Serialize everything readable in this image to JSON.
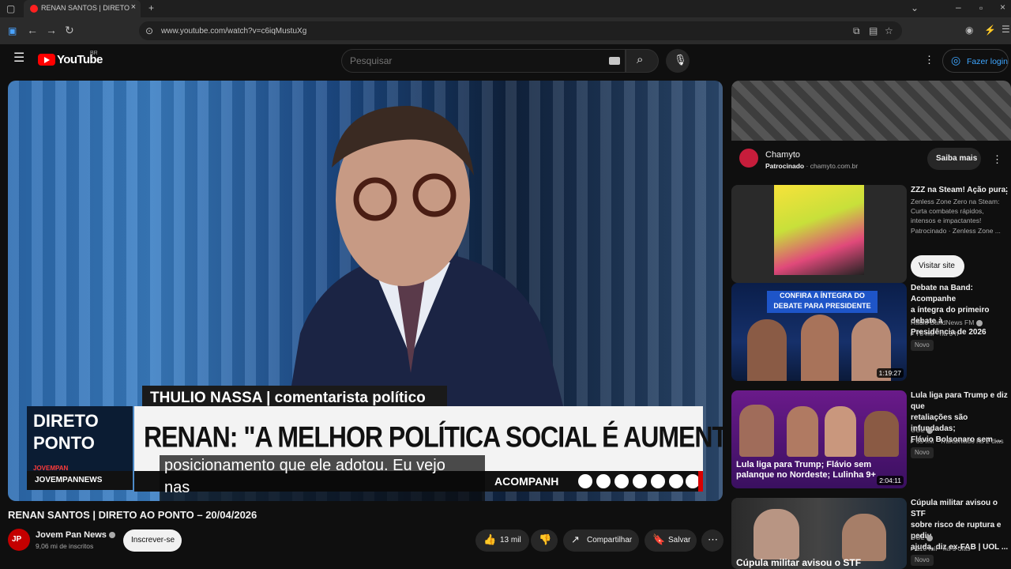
{
  "browser": {
    "tab_title": "RENAN SANTOS | DIRETO AO P",
    "url": "www.youtube.com/watch?v=c6iqMustuXg"
  },
  "header": {
    "logo_text": "YouTube",
    "country_code": "BR",
    "search_placeholder": "Pesquisar",
    "login_label": "Fazer login"
  },
  "video": {
    "lower_third_name": "THULIO NASSA | comentarista político",
    "headline": "RENAN: \"A MELHOR POLÍTICA SOCIAL É AUMENTAR A RENDA\"",
    "brand_line1": "DIRETO",
    "brand_line2": "PONTO",
    "brand_sub": "JOVEMPAN",
    "network": "JOVEMPANNEWS",
    "ticker": "ACOMPANH",
    "caption_line1": "posicionamento que ele adotou. Eu vejo",
    "caption_line2": "nas"
  },
  "info": {
    "title": "RENAN SANTOS | DIRETO AO PONTO – 20/04/2026",
    "channel": "Jovem Pan News",
    "subscribers": "9,06 mi de inscritos",
    "subscribe_label": "Inscrever-se",
    "likes": "13 mil",
    "share_label": "Compartilhar",
    "save_label": "Salvar",
    "avatar_text": "JP"
  },
  "sidebar": {
    "ad": {
      "name": "Chamyto",
      "sponsored": "Patrocinado",
      "domain": "chamyto.com.br",
      "cta": "Saiba mais"
    },
    "promo": {
      "title": "ZZZ na Steam! Ação pura.",
      "desc1": "Zenless Zone Zero na Steam:",
      "desc2": "Curta combates rápidos,",
      "desc3": "intensos e impactantes!",
      "sponsor": "Patrocinado · Zenless Zone ...",
      "cta": "Visitar site"
    },
    "items": [
      {
        "title_l1": "Debate na Band: Acompanhe",
        "title_l2": "a íntegra do primeiro debate à",
        "title_l3": "Presidência de 2026",
        "channel": "Rádio BandNews FM",
        "meta": "78 mil · há 9 h",
        "badge": "Novo",
        "duration": "1:19:27",
        "thumb_text": "CONFIRA A ÍNTEGRA DO DEBATE PARA PRESIDENTE"
      },
      {
        "title_l1": "Lula liga para Trump e diz que",
        "title_l2": "retaliações são infundadas;",
        "title_l3": "Flávio Bolsonaro sem ...",
        "channel": "UOL",
        "meta": "65 mil · Transmitido há 2 dias",
        "badge": "Novo",
        "duration": "2:04:11",
        "thumb_text": "Lula liga para Trump; Flávio sem palanque no Nordeste; Lulinha 9+"
      },
      {
        "title_l1": "Cúpula militar avisou o STF",
        "title_l2": "sobre risco de ruptura e pediu",
        "title_l3": "ajuda, diz ex-FAB | UOL ...",
        "channel": "UOL",
        "meta": "110 mil · há 5 dias",
        "badge": "Novo",
        "thumb_text": "Cúpula militar avisou o STF"
      }
    ]
  }
}
